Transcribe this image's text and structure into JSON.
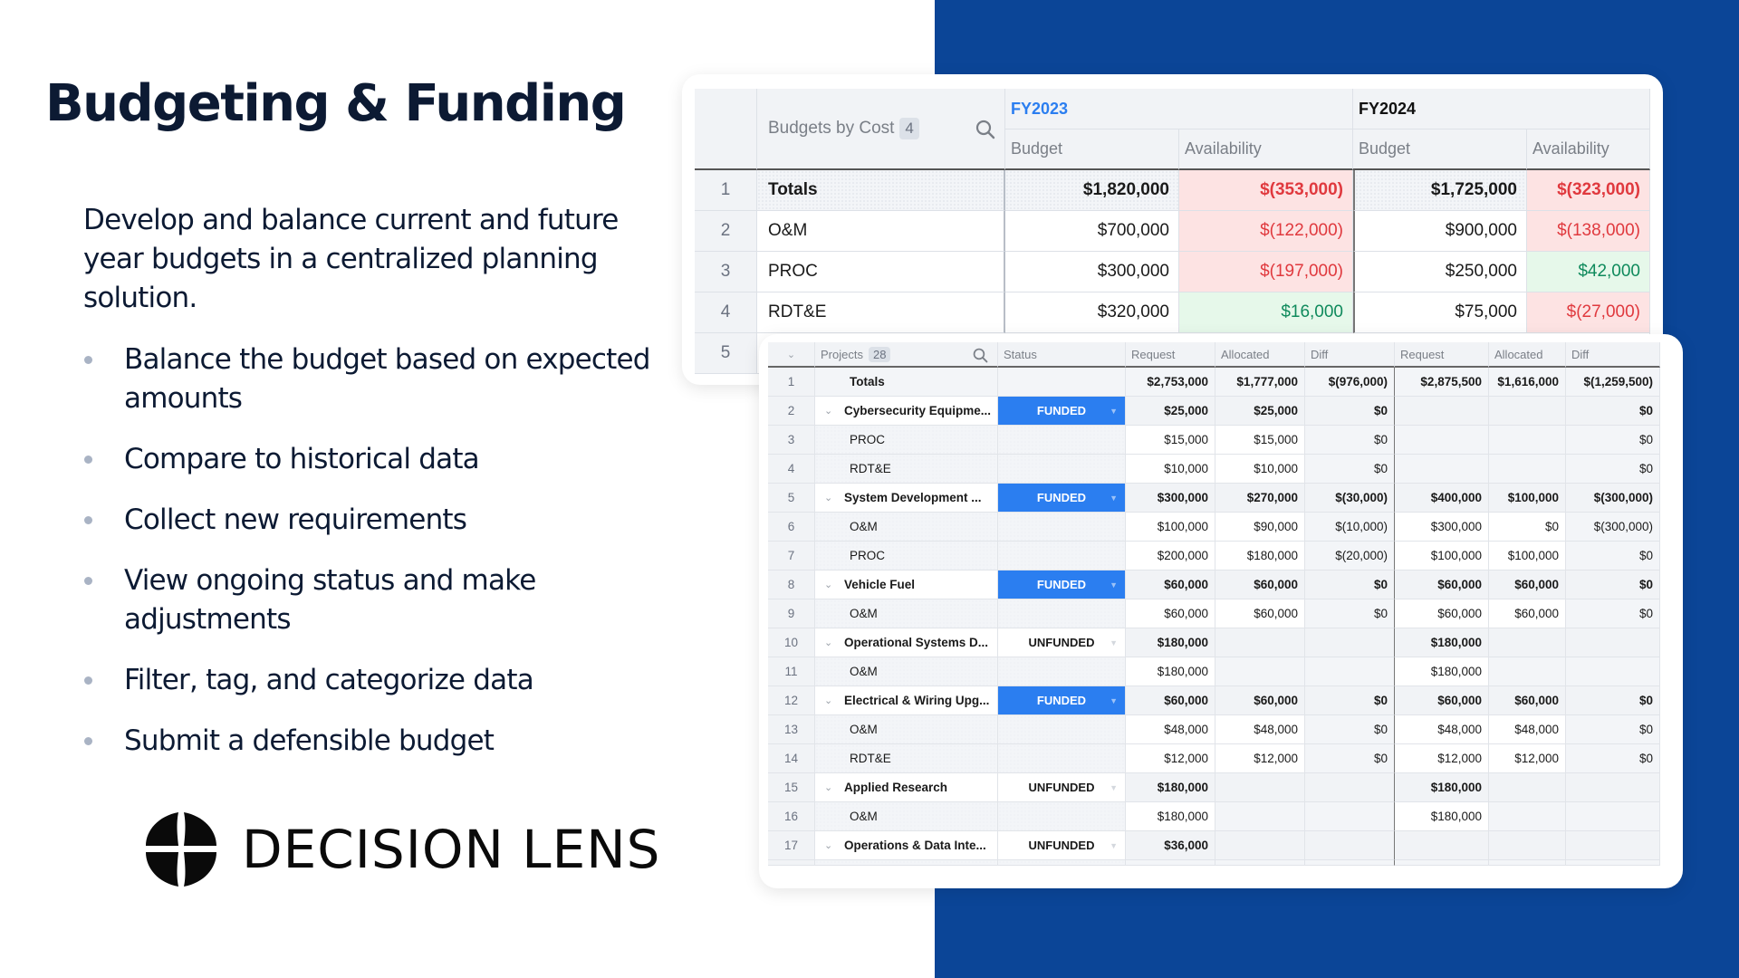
{
  "slide": {
    "title": "Budgeting & Funding",
    "intro": "Develop and balance current and future year budgets in a centralized planning solution.",
    "bullets": [
      "Balance the budget based on expected amounts",
      "Compare to historical data",
      "Collect new requirements",
      "View ongoing status and make adjustments",
      "Filter, tag, and categorize data",
      "Submit a defensible budget"
    ],
    "logo_text": "DECISION LENS",
    "colors": {
      "accent_blue": "#0b4597",
      "title": "#0c1a33",
      "funded": "#2b7ef0",
      "negative": "#e0393e",
      "positive": "#0f8a5c"
    }
  },
  "budgets_table": {
    "header": {
      "label": "Budgets by Cost",
      "count": "4",
      "search_icon": "search-icon"
    },
    "groups": [
      {
        "label": "FY2023",
        "columns": [
          "Budget",
          "Availability"
        ]
      },
      {
        "label": "FY2024",
        "columns": [
          "Budget",
          "Availability"
        ]
      }
    ],
    "rows": [
      {
        "num": "1",
        "name": "Totals",
        "fy2023_budget": "$1,820,000",
        "fy2023_avail": "$(353,000)",
        "fy2024_budget": "$1,725,000",
        "fy2024_avail": "$(323,000)"
      },
      {
        "num": "2",
        "name": "O&M",
        "fy2023_budget": "$700,000",
        "fy2023_avail": "$(122,000)",
        "fy2024_budget": "$900,000",
        "fy2024_avail": "$(138,000)"
      },
      {
        "num": "3",
        "name": "PROC",
        "fy2023_budget": "$300,000",
        "fy2023_avail": "$(197,000)",
        "fy2024_budget": "$250,000",
        "fy2024_avail": "$42,000"
      },
      {
        "num": "4",
        "name": "RDT&E",
        "fy2023_budget": "$320,000",
        "fy2023_avail": "$16,000",
        "fy2024_budget": "$75,000",
        "fy2024_avail": "$(27,000)"
      },
      {
        "num": "5"
      }
    ]
  },
  "projects_table": {
    "header": {
      "label": "Projects",
      "count": "28",
      "status": "Status",
      "columns": [
        "Request",
        "Allocated",
        "Diff",
        "Request",
        "Allocated",
        "Diff"
      ]
    },
    "rows": [
      {
        "num": "1",
        "name": "Totals",
        "status": "",
        "v": [
          "$2,753,000",
          "$1,777,000",
          "$(976,000)",
          "$2,875,500",
          "$1,616,000",
          "$(1,259,500)"
        ]
      },
      {
        "num": "2",
        "name": "Cybersecurity Equipme...",
        "status": "FUNDED",
        "v": [
          "$25,000",
          "$25,000",
          "$0",
          "",
          "",
          "$0"
        ]
      },
      {
        "num": "3",
        "name": "PROC",
        "status": "",
        "v": [
          "$15,000",
          "$15,000",
          "$0",
          "",
          "",
          "$0"
        ]
      },
      {
        "num": "4",
        "name": "RDT&E",
        "status": "",
        "v": [
          "$10,000",
          "$10,000",
          "$0",
          "",
          "",
          "$0"
        ]
      },
      {
        "num": "5",
        "name": "System Development ...",
        "status": "FUNDED",
        "v": [
          "$300,000",
          "$270,000",
          "$(30,000)",
          "$400,000",
          "$100,000",
          "$(300,000)"
        ]
      },
      {
        "num": "6",
        "name": "O&M",
        "status": "",
        "v": [
          "$100,000",
          "$90,000",
          "$(10,000)",
          "$300,000",
          "$0",
          "$(300,000)"
        ]
      },
      {
        "num": "7",
        "name": "PROC",
        "status": "",
        "v": [
          "$200,000",
          "$180,000",
          "$(20,000)",
          "$100,000",
          "$100,000",
          "$0"
        ]
      },
      {
        "num": "8",
        "name": "Vehicle Fuel",
        "status": "FUNDED",
        "v": [
          "$60,000",
          "$60,000",
          "$0",
          "$60,000",
          "$60,000",
          "$0"
        ]
      },
      {
        "num": "9",
        "name": "O&M",
        "status": "",
        "v": [
          "$60,000",
          "$60,000",
          "$0",
          "$60,000",
          "$60,000",
          "$0"
        ]
      },
      {
        "num": "10",
        "name": "Operational Systems D...",
        "status": "UNFUNDED",
        "v": [
          "$180,000",
          "",
          "",
          "$180,000",
          "",
          ""
        ]
      },
      {
        "num": "11",
        "name": "O&M",
        "status": "",
        "v": [
          "$180,000",
          "",
          "",
          "$180,000",
          "",
          ""
        ]
      },
      {
        "num": "12",
        "name": "Electrical & Wiring Upg...",
        "status": "FUNDED",
        "v": [
          "$60,000",
          "$60,000",
          "$0",
          "$60,000",
          "$60,000",
          "$0"
        ]
      },
      {
        "num": "13",
        "name": "O&M",
        "status": "",
        "v": [
          "$48,000",
          "$48,000",
          "$0",
          "$48,000",
          "$48,000",
          "$0"
        ]
      },
      {
        "num": "14",
        "name": "RDT&E",
        "status": "",
        "v": [
          "$12,000",
          "$12,000",
          "$0",
          "$12,000",
          "$12,000",
          "$0"
        ]
      },
      {
        "num": "15",
        "name": "Applied Research",
        "status": "UNFUNDED",
        "v": [
          "$180,000",
          "",
          "",
          "$180,000",
          "",
          ""
        ]
      },
      {
        "num": "16",
        "name": "O&M",
        "status": "",
        "v": [
          "$180,000",
          "",
          "",
          "$180,000",
          "",
          ""
        ]
      },
      {
        "num": "17",
        "name": "Operations & Data Inte...",
        "status": "UNFUNDED",
        "v": [
          "$36,000",
          "",
          "",
          "",
          "",
          ""
        ]
      }
    ]
  }
}
